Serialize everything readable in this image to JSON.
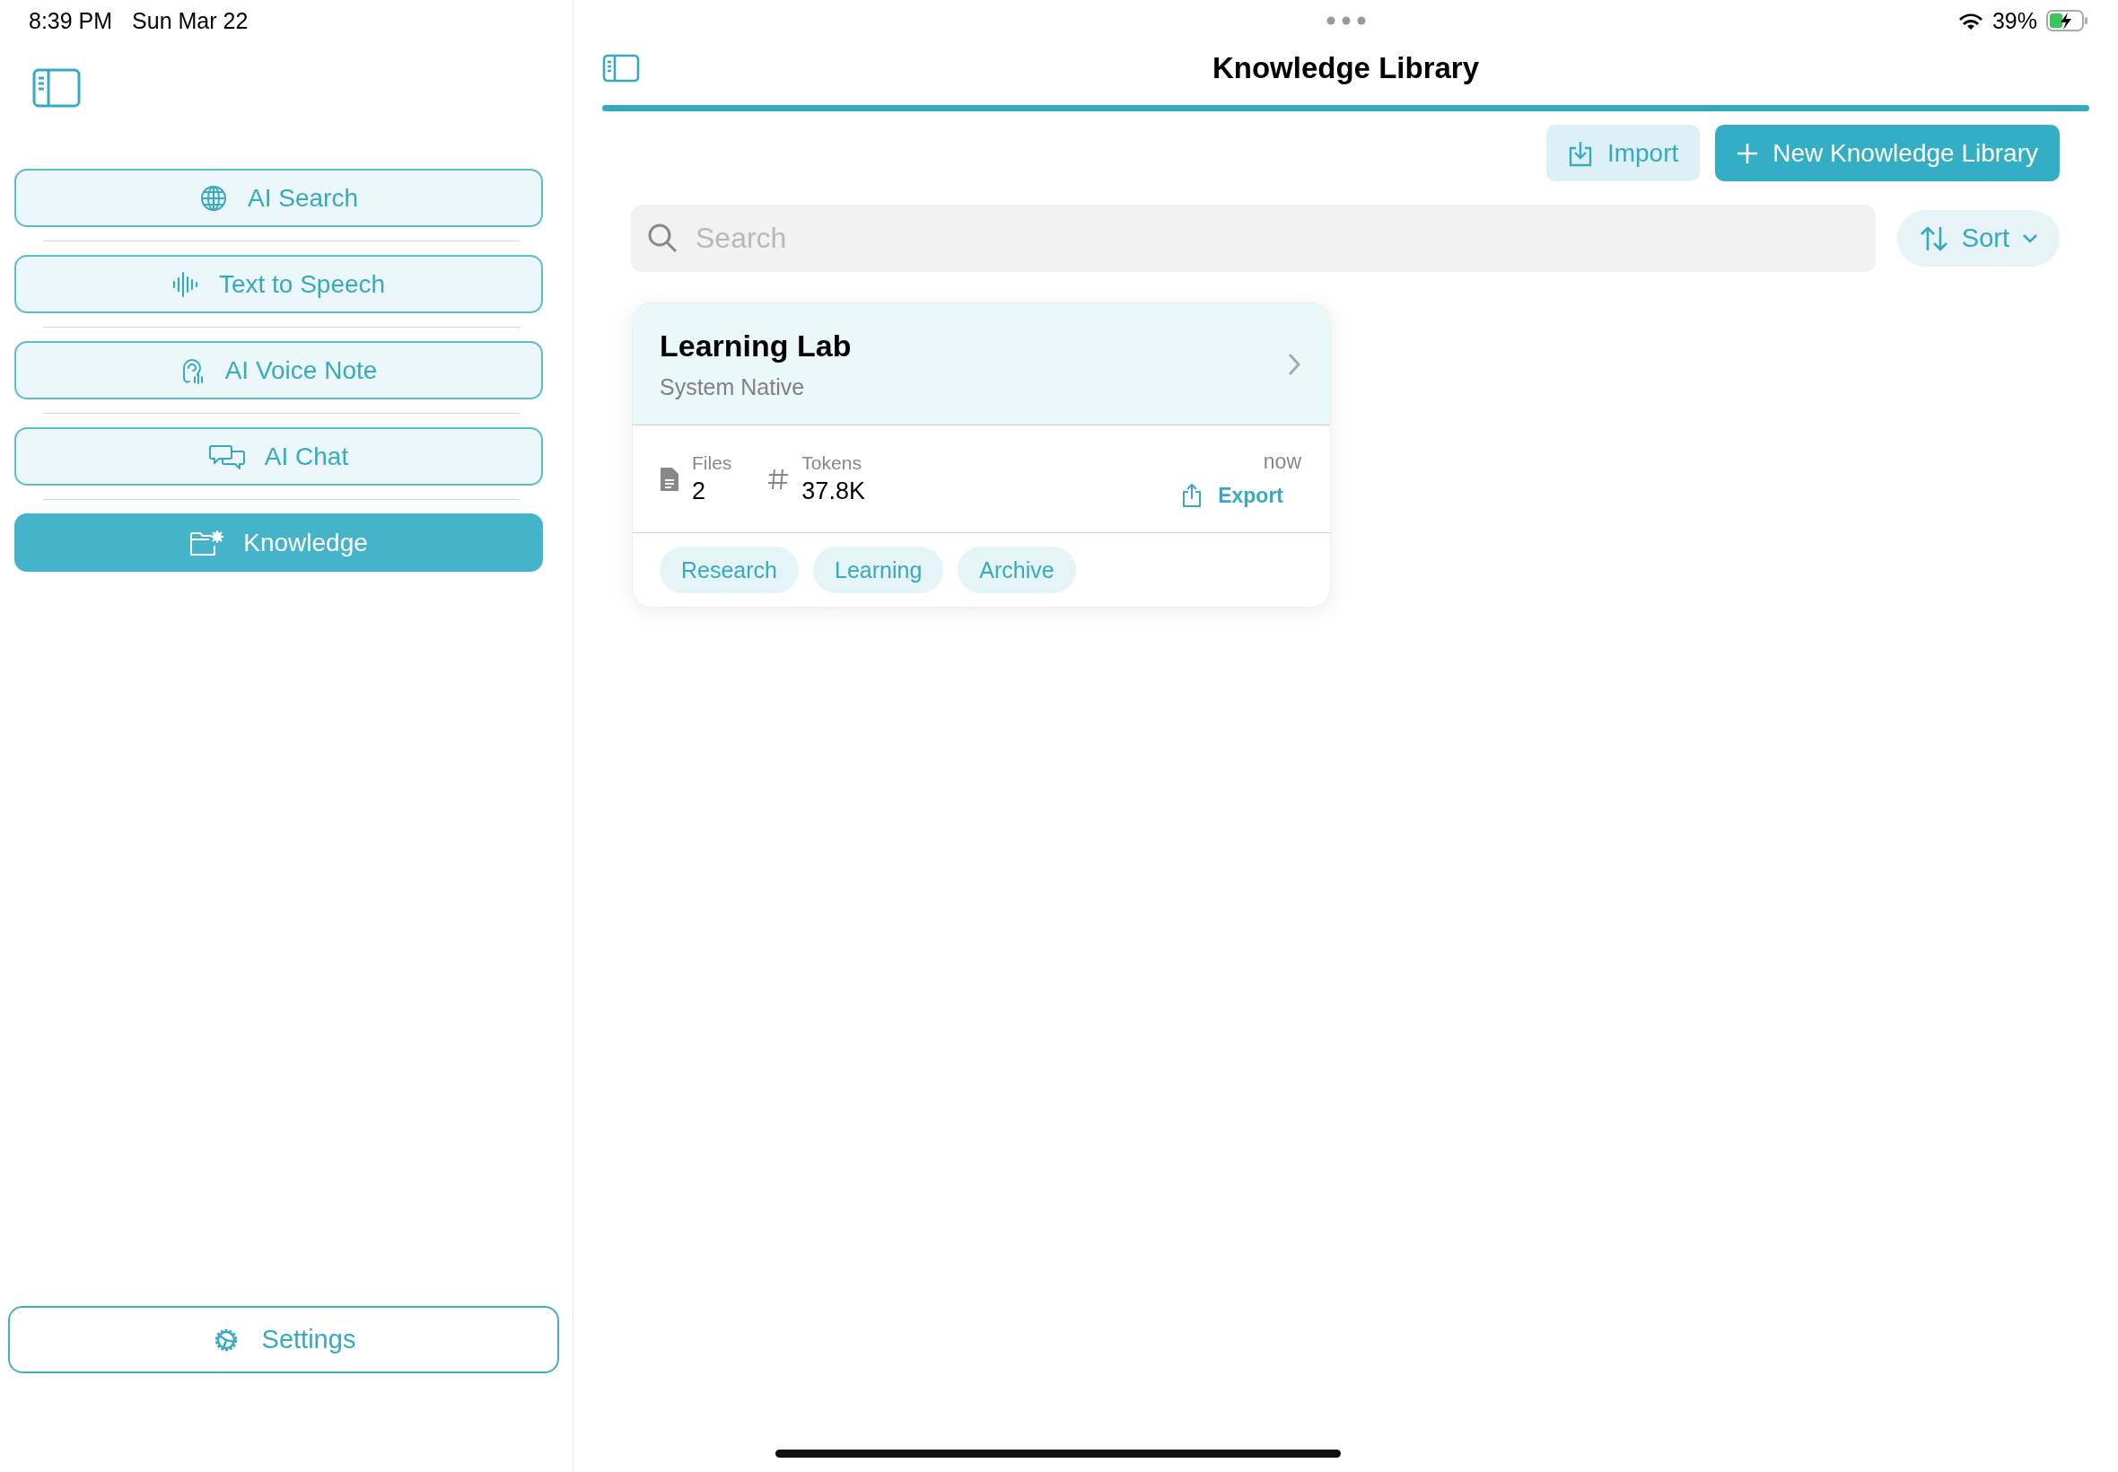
{
  "status_bar": {
    "time": "8:39 PM",
    "date": "Sun Mar 22",
    "battery": "39%"
  },
  "sidebar": {
    "items": [
      {
        "label": "AI Search",
        "kind": "globe",
        "selected": false
      },
      {
        "label": "Text to Speech",
        "kind": "waveform",
        "selected": false
      },
      {
        "label": "AI Voice Note",
        "kind": "ear",
        "selected": false
      },
      {
        "label": "AI Chat",
        "kind": "chat",
        "selected": false
      },
      {
        "label": "Knowledge",
        "kind": "folder",
        "selected": true
      }
    ],
    "settings": {
      "label": "Settings"
    }
  },
  "header": {
    "title": "Knowledge Library"
  },
  "toolbar": {
    "import": "Import",
    "new": "New Knowledge Library"
  },
  "search": {
    "placeholder": "Search"
  },
  "sort": {
    "label": "Sort"
  },
  "libraries": [
    {
      "title": "Learning Lab",
      "subtitle": "System Native",
      "stats": [
        {
          "kind": "file",
          "label": "Files",
          "value": "2"
        },
        {
          "kind": "hash",
          "label": "Tokens",
          "value": "37.8K"
        }
      ],
      "updated": "now",
      "export": "Export",
      "tags": [
        "Research",
        "Learning",
        "Archive"
      ]
    }
  ]
}
